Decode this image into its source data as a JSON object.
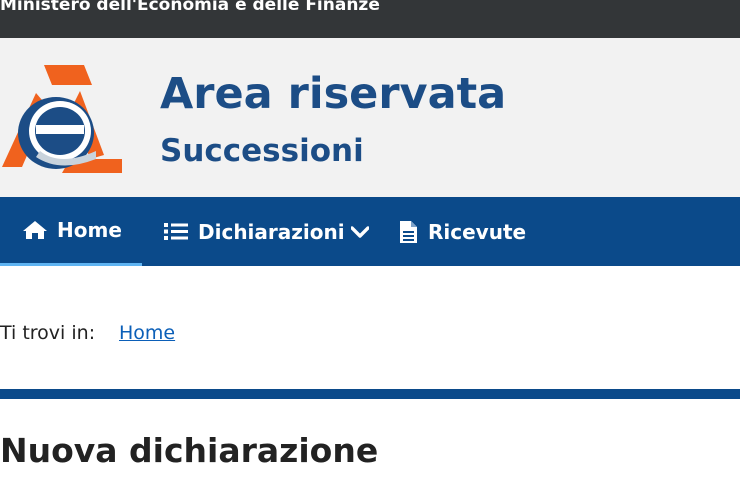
{
  "topbar": {
    "ministry": "Ministero dell'Economia e delle Finanze"
  },
  "header": {
    "title": "Area riservata",
    "subtitle": "Successioni"
  },
  "nav": {
    "items": [
      {
        "label": "Home",
        "icon": "home-icon",
        "active": true
      },
      {
        "label": "Dichiarazioni",
        "icon": "list-icon",
        "dropdown": true
      },
      {
        "label": "Ricevute",
        "icon": "document-icon"
      }
    ]
  },
  "breadcrumb": {
    "prefix": "Ti trovi in:",
    "items": [
      "Home"
    ]
  },
  "main": {
    "title": "Nuova dichiarazione"
  },
  "colors": {
    "topbar": "#333638",
    "header_bg": "#f2f2f2",
    "brand_blue": "#1c4d86",
    "nav_bg": "#0b4a8a",
    "nav_active_underline": "#5fb4f2",
    "link": "#0b5fb8",
    "logo_orange": "#f0621e"
  }
}
